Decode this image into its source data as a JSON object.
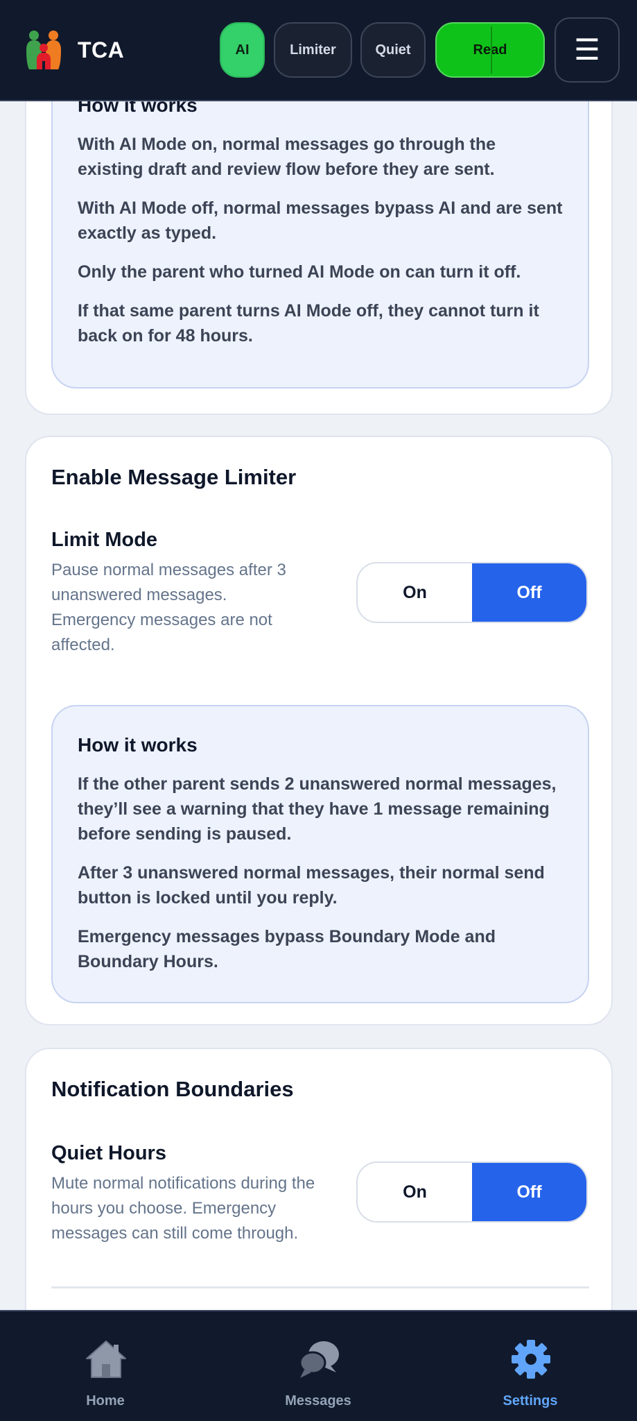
{
  "header": {
    "app_name": "TCA",
    "pills": {
      "ai": "AI",
      "limiter": "Limiter",
      "quiet": "Quiet",
      "read": "Read"
    },
    "menu_glyph": "☰"
  },
  "ai_card": {
    "how_title": "How it works",
    "how_paragraphs": [
      "With AI Mode on, normal messages go through the existing draft and review flow before they are sent.",
      "With AI Mode off, normal messages bypass AI and are sent exactly as typed.",
      "Only the parent who turned AI Mode on can turn it off.",
      "If that same parent turns AI Mode off, they cannot turn it back on for 48 hours."
    ]
  },
  "limiter_card": {
    "title": "Enable Message Limiter",
    "setting_title": "Limit Mode",
    "setting_desc": "Pause normal messages after 3 unanswered messages. Emergency messages are not affected.",
    "toggle": {
      "on": "On",
      "off": "Off",
      "selected": "Off"
    },
    "how_title": "How it works",
    "how_paragraphs": [
      "If the other parent sends 2 unanswered normal messages, they’ll see a warning that they have 1 message remaining before sending is paused.",
      "After 3 unanswered normal messages, their normal send button is locked until you reply.",
      "Emergency messages bypass Boundary Mode and Boundary Hours."
    ]
  },
  "notif_card": {
    "title": "Notification Boundaries",
    "setting_title": "Quiet Hours",
    "setting_desc": "Mute normal notifications during the hours you choose. Emergency messages can still come through.",
    "toggle": {
      "on": "On",
      "off": "Off",
      "selected": "Off"
    }
  },
  "bottom_nav": {
    "items": [
      {
        "label": "Home",
        "icon": "home-icon"
      },
      {
        "label": "Messages",
        "icon": "chat-bubbles-icon"
      },
      {
        "label": "Settings",
        "icon": "gear-icon",
        "active": true
      }
    ]
  },
  "colors": {
    "header_bg": "#111a2c",
    "accent_blue": "#2563eb",
    "ai_pill_green": "#34d06a",
    "read_pill_green": "#0fc21a",
    "active_nav": "#60a5fa"
  }
}
